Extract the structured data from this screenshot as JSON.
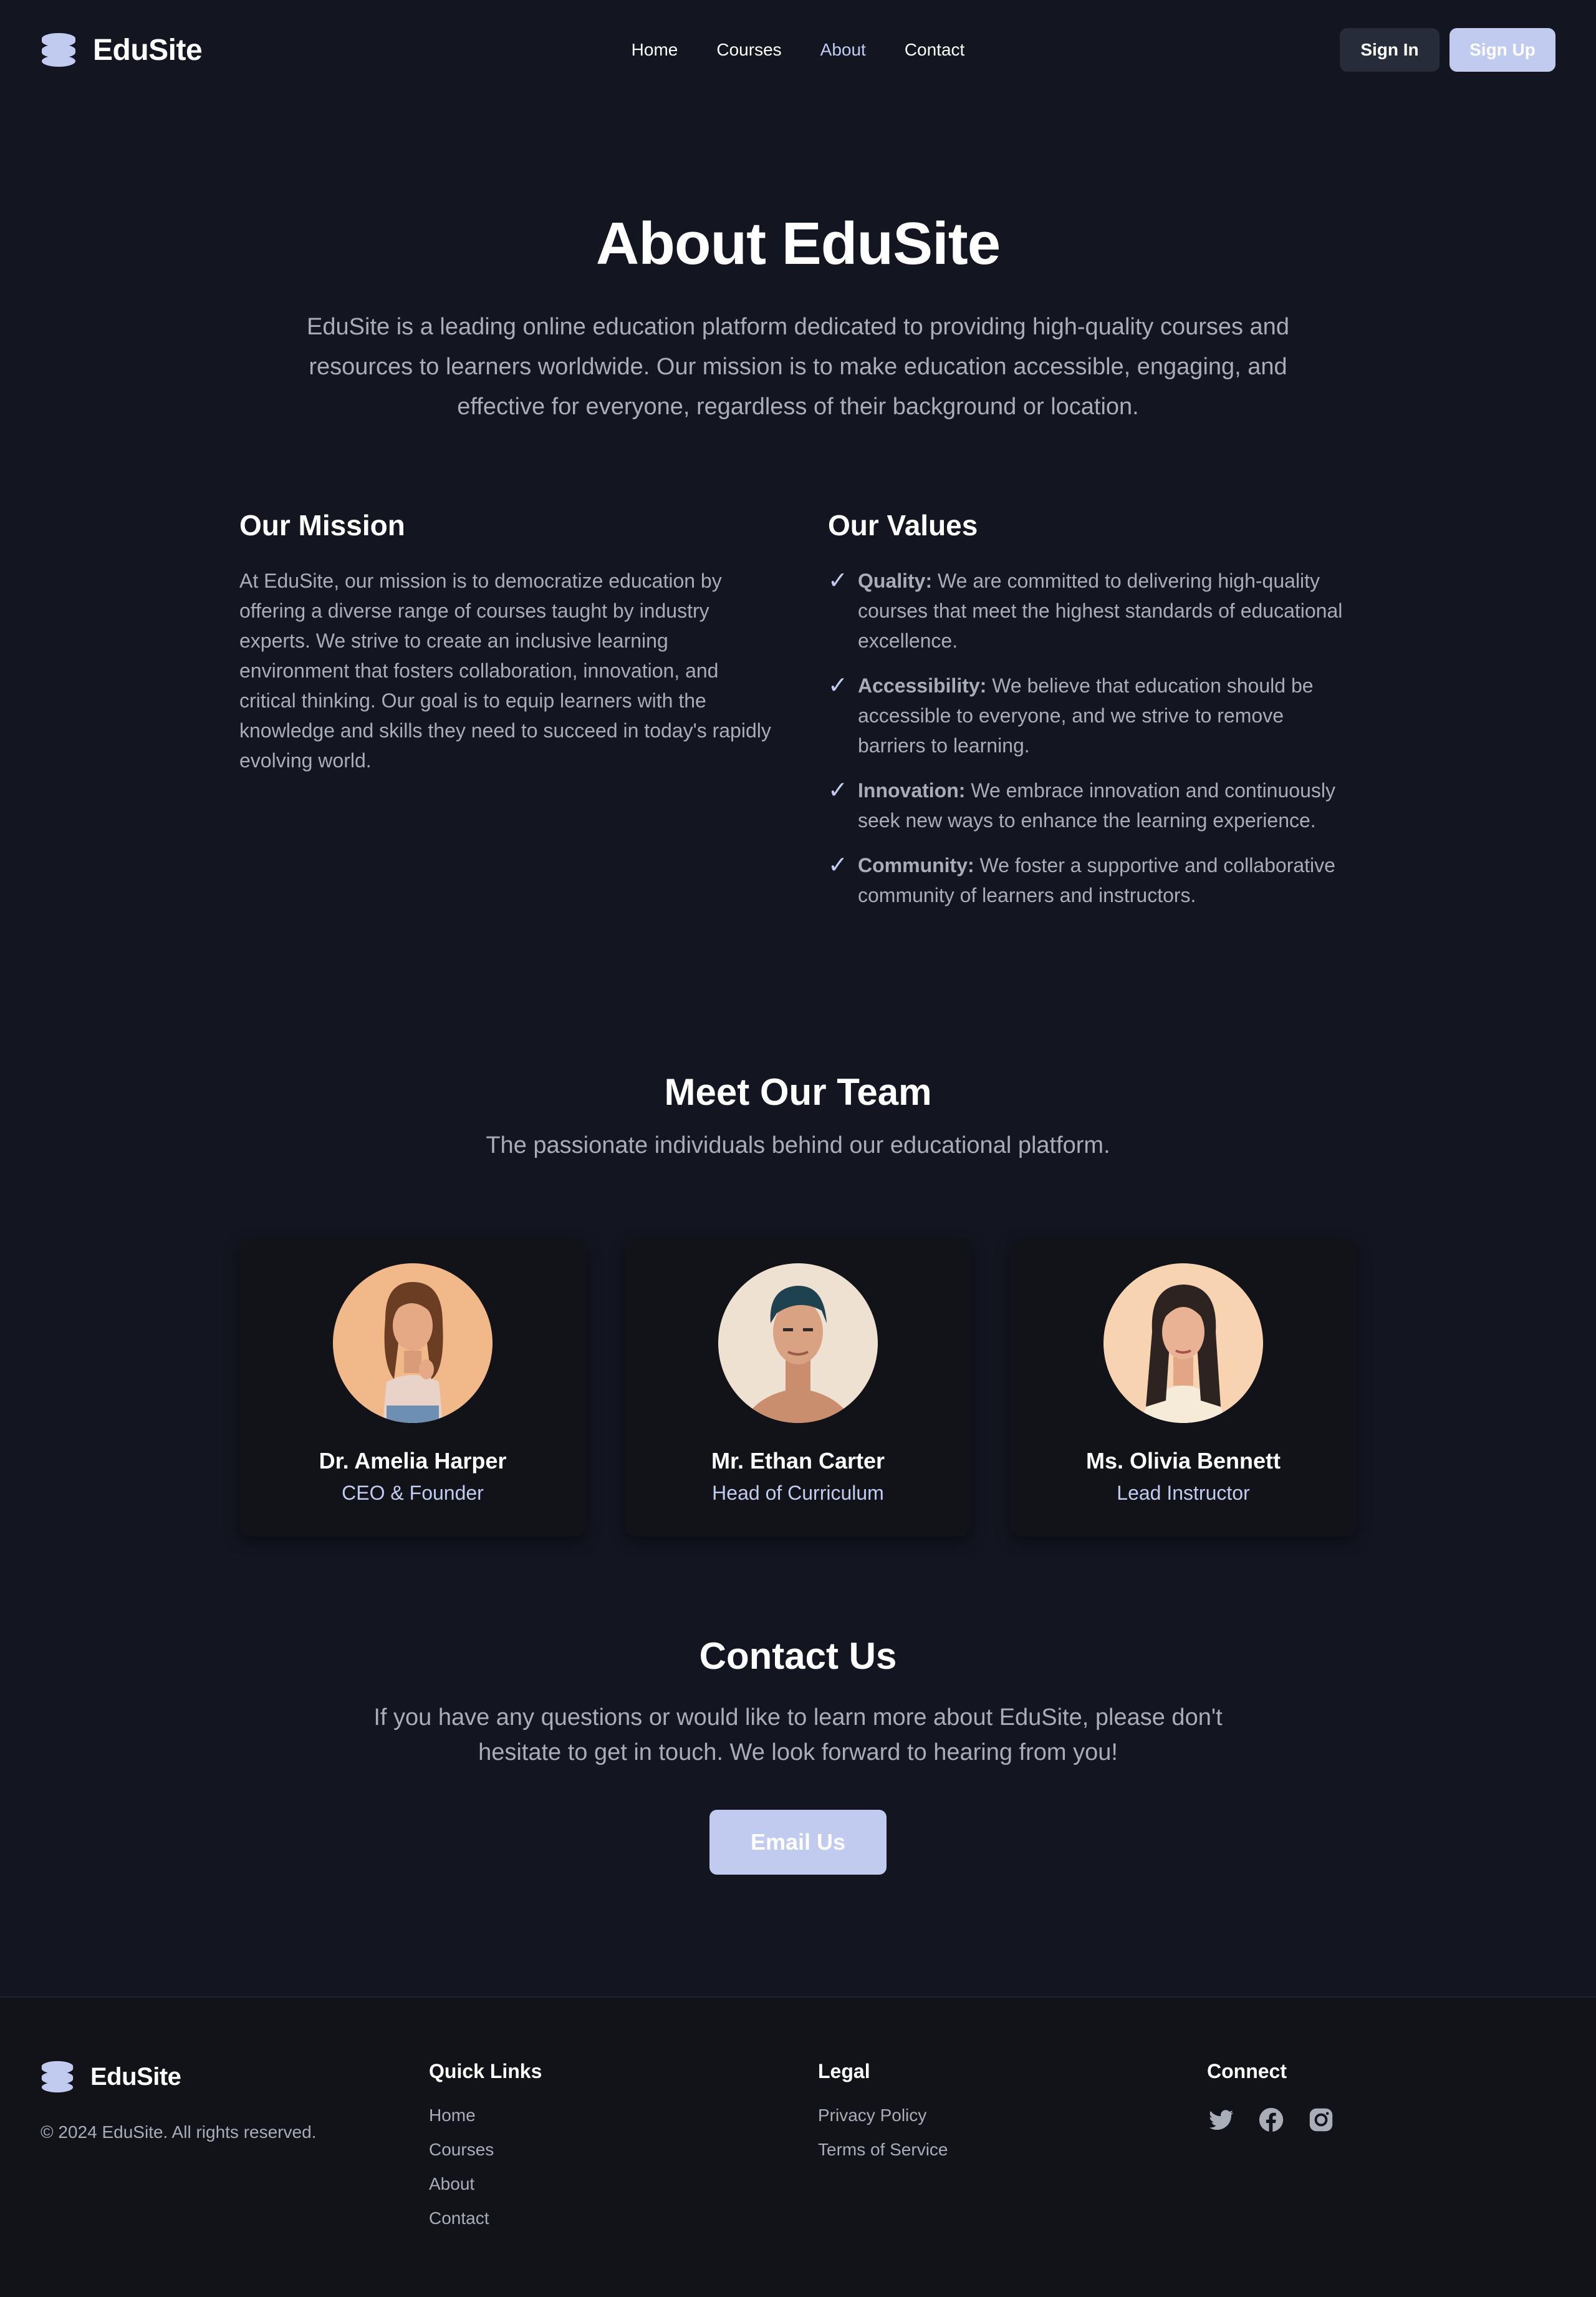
{
  "brand": {
    "name": "EduSite"
  },
  "nav": {
    "links": [
      {
        "label": "Home"
      },
      {
        "label": "Courses"
      },
      {
        "label": "About"
      },
      {
        "label": "Contact"
      }
    ],
    "sign_in": "Sign In",
    "sign_up": "Sign Up"
  },
  "hero": {
    "title": "About EduSite",
    "text": "EduSite is a leading online education platform dedicated to providing high-quality courses and resources to learners worldwide. Our mission is to make education accessible, engaging, and effective for everyone, regardless of their background or location."
  },
  "mission": {
    "title": "Our Mission",
    "text": "At EduSite, our mission is to democratize education by offering a diverse range of courses taught by industry experts. We strive to create an inclusive learning environment that fosters collaboration, innovation, and critical thinking. Our goal is to equip learners with the knowledge and skills they need to succeed in today's rapidly evolving world."
  },
  "values": {
    "title": "Our Values",
    "items": [
      {
        "name": "Quality:",
        "text": " We are committed to delivering high-quality courses that meet the highest standards of educational excellence."
      },
      {
        "name": "Accessibility:",
        "text": " We believe that education should be accessible to everyone, and we strive to remove barriers to learning."
      },
      {
        "name": "Innovation:",
        "text": " We embrace innovation and continuously seek new ways to enhance the learning experience."
      },
      {
        "name": "Community:",
        "text": " We foster a supportive and collaborative community of learners and instructors."
      }
    ]
  },
  "team": {
    "title": "Meet Our Team",
    "subtitle": "The passionate individuals behind our educational platform.",
    "members": [
      {
        "name": "Dr. Amelia Harper",
        "role": "CEO & Founder"
      },
      {
        "name": "Mr. Ethan Carter",
        "role": "Head of Curriculum"
      },
      {
        "name": "Ms. Olivia Bennett",
        "role": "Lead Instructor"
      }
    ]
  },
  "contact": {
    "title": "Contact Us",
    "text": "If you have any questions or would like to learn more about EduSite, please don't hesitate to get in touch. We look forward to hearing from you!",
    "button": "Email Us"
  },
  "footer": {
    "brand": "EduSite",
    "copyright": "© 2024 EduSite. All rights reserved.",
    "quick_links": {
      "title": "Quick Links",
      "items": [
        "Home",
        "Courses",
        "About",
        "Contact"
      ]
    },
    "legal": {
      "title": "Legal",
      "items": [
        "Privacy Policy",
        "Terms of Service"
      ]
    },
    "connect": {
      "title": "Connect",
      "icons": [
        "twitter-icon",
        "facebook-icon",
        "instagram-icon"
      ]
    }
  },
  "colors": {
    "background": "#131520",
    "accent": "#c1cbef",
    "muted_text": "#a9adb8"
  }
}
